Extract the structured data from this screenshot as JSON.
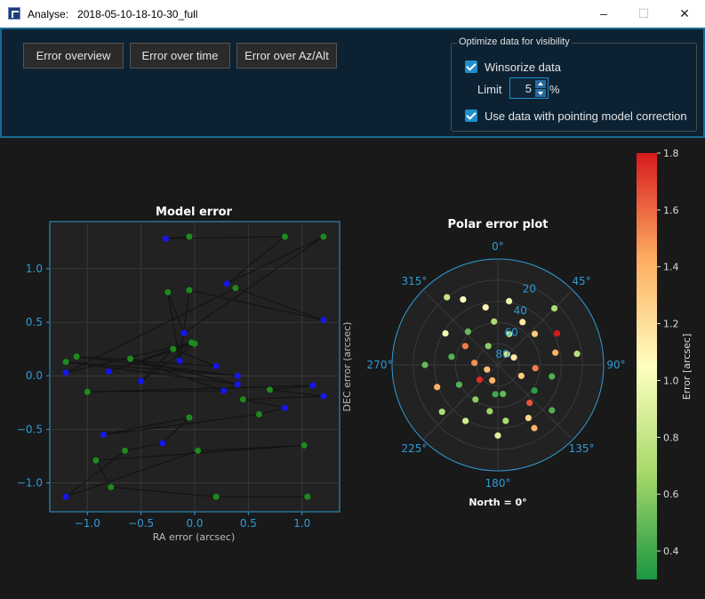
{
  "window": {
    "app_label": "Analyse:",
    "file_name": "2018-05-10-18-10-30_full",
    "minimize_glyph": "–",
    "maximize_glyph": "☐",
    "close_glyph": "✕"
  },
  "toolbar": {
    "btn_overview": "Error overview",
    "btn_time": "Error over time",
    "btn_azalt": "Error over Az/Alt"
  },
  "optimize": {
    "legend": "Optimize data for visibility",
    "winsorize_label": "Winsorize data",
    "winsorize_checked": true,
    "limit_label": "Limit",
    "limit_value": "5",
    "limit_unit": "%",
    "pointing_label": "Use data with pointing model correction",
    "pointing_checked": true
  },
  "colors": {
    "accent": "#1f8fc9",
    "axis": "#2f9bd6",
    "blue_points": "#1515ee",
    "green_points": "#1d8a1d"
  },
  "chart_data": [
    {
      "type": "scatter",
      "title": "Model error",
      "xlabel": "RA error (arcsec)",
      "ylabel": "DEC error (arcsec)",
      "xlim": [
        -1.35,
        1.35
      ],
      "ylim": [
        -1.27,
        1.44
      ],
      "xticks": [
        -1.0,
        -0.5,
        0.0,
        0.5,
        1.0
      ],
      "xtick_labels": [
        "−1.0",
        "−0.5",
        "0.0",
        "0.5",
        "1.0"
      ],
      "yticks": [
        -1.0,
        -0.5,
        0.0,
        0.5,
        1.0
      ],
      "ytick_labels": [
        "−1.0",
        "−0.5",
        "0.0",
        "0.5",
        "1.0"
      ],
      "grid": true,
      "series": [
        {
          "color": "blue",
          "points": [
            [
              -0.27,
              1.28
            ],
            [
              0.3,
              0.86
            ],
            [
              -0.1,
              0.4
            ],
            [
              -0.14,
              0.14
            ],
            [
              1.2,
              0.52
            ],
            [
              -1.2,
              0.03
            ],
            [
              -0.8,
              0.04
            ],
            [
              -0.5,
              -0.05
            ],
            [
              0.2,
              0.09
            ],
            [
              0.4,
              0.0
            ],
            [
              0.4,
              -0.08
            ],
            [
              0.27,
              -0.14
            ],
            [
              1.1,
              -0.09
            ],
            [
              1.2,
              -0.19
            ],
            [
              0.84,
              -0.3
            ],
            [
              -0.85,
              -0.55
            ],
            [
              -0.3,
              -0.63
            ],
            [
              -1.2,
              -1.13
            ]
          ]
        },
        {
          "color": "green",
          "points": [
            [
              -0.05,
              1.3
            ],
            [
              0.84,
              1.3
            ],
            [
              1.2,
              1.3
            ],
            [
              -0.25,
              0.78
            ],
            [
              -0.05,
              0.8
            ],
            [
              0.38,
              0.82
            ],
            [
              -0.03,
              0.31
            ],
            [
              0.0,
              0.3
            ],
            [
              -0.2,
              0.25
            ],
            [
              -1.1,
              0.18
            ],
            [
              -1.2,
              0.13
            ],
            [
              -0.6,
              0.16
            ],
            [
              -1.0,
              -0.15
            ],
            [
              0.7,
              -0.13
            ],
            [
              0.45,
              -0.22
            ],
            [
              0.6,
              -0.36
            ],
            [
              -0.05,
              -0.39
            ],
            [
              -0.65,
              -0.7
            ],
            [
              0.03,
              -0.7
            ],
            [
              1.02,
              -0.65
            ],
            [
              -0.92,
              -0.79
            ],
            [
              -0.78,
              -1.04
            ],
            [
              0.2,
              -1.13
            ],
            [
              1.05,
              -1.13
            ]
          ]
        }
      ]
    },
    {
      "type": "scatter",
      "subtype": "polar",
      "title": "Polar error plot",
      "footer": "North = 0°",
      "angle_labels": [
        "0°",
        "45°",
        "90°",
        "135°",
        "180°",
        "225°",
        "270°",
        "315°"
      ],
      "radial_labels": [
        "20",
        "40",
        "60",
        "80"
      ],
      "colorbar": {
        "label": "Error [arcsec]",
        "ticks": [
          "1.8",
          "1.6",
          "1.4",
          "1.2",
          "1.0",
          "0.8",
          "0.6",
          "0.4"
        ],
        "range": [
          0.3,
          1.8
        ]
      },
      "points": [
        {
          "az": 30,
          "alt": 48,
          "err": 1.15
        },
        {
          "az": 10,
          "alt": 35,
          "err": 0.95
        },
        {
          "az": 332,
          "alt": 27,
          "err": 1.05
        },
        {
          "az": 348,
          "alt": 40,
          "err": 1.1
        },
        {
          "az": 355,
          "alt": 53,
          "err": 0.7
        },
        {
          "az": 20,
          "alt": 62,
          "err": 0.8
        },
        {
          "az": 323,
          "alt": 18,
          "err": 0.8
        },
        {
          "az": 45,
          "alt": 22,
          "err": 0.7
        },
        {
          "az": 62,
          "alt": 33,
          "err": 1.85
        },
        {
          "az": 50,
          "alt": 49,
          "err": 1.3
        },
        {
          "az": 40,
          "alt": 78,
          "err": 0.85
        },
        {
          "az": 333,
          "alt": 72,
          "err": 0.6
        },
        {
          "az": 318,
          "alt": 52,
          "err": 0.5
        },
        {
          "az": 301,
          "alt": 38,
          "err": 1.0
        },
        {
          "az": 300,
          "alt": 58,
          "err": 1.55
        },
        {
          "az": 275,
          "alt": 70,
          "err": 1.5
        },
        {
          "az": 280,
          "alt": 50,
          "err": 0.45
        },
        {
          "az": 270,
          "alt": 28,
          "err": 0.5
        },
        {
          "az": 250,
          "alt": 35,
          "err": 1.4
        },
        {
          "az": 243,
          "alt": 53,
          "err": 0.45
        },
        {
          "az": 213,
          "alt": 55,
          "err": 0.6
        },
        {
          "az": 231,
          "alt": 70,
          "err": 1.75
        },
        {
          "az": 247,
          "alt": 80,
          "err": 1.35
        },
        {
          "az": 230,
          "alt": 28,
          "err": 0.7
        },
        {
          "az": 210,
          "alt": 35,
          "err": 0.85
        },
        {
          "az": 190,
          "alt": 50,
          "err": 0.65
        },
        {
          "az": 185,
          "alt": 65,
          "err": 0.4
        },
        {
          "az": 180,
          "alt": 30,
          "err": 0.9
        },
        {
          "az": 172,
          "alt": 42,
          "err": 0.7
        },
        {
          "az": 150,
          "alt": 28,
          "err": 1.4
        },
        {
          "az": 150,
          "alt": 38,
          "err": 1.25
        },
        {
          "az": 130,
          "alt": 30,
          "err": 0.45
        },
        {
          "az": 140,
          "alt": 48,
          "err": 1.65
        },
        {
          "az": 125,
          "alt": 52,
          "err": 0.35
        },
        {
          "az": 102,
          "alt": 43,
          "err": 0.45
        },
        {
          "az": 115,
          "alt": 68,
          "err": 1.3
        },
        {
          "az": 95,
          "alt": 58,
          "err": 1.55
        },
        {
          "az": 82,
          "alt": 22,
          "err": 0.75
        },
        {
          "az": 78,
          "alt": 40,
          "err": 1.4
        },
        {
          "az": 65,
          "alt": 75,
          "err": 1.15
        },
        {
          "az": 170,
          "alt": 65,
          "err": 0.5
        },
        {
          "az": 200,
          "alt": 76,
          "err": 1.4
        }
      ]
    }
  ]
}
